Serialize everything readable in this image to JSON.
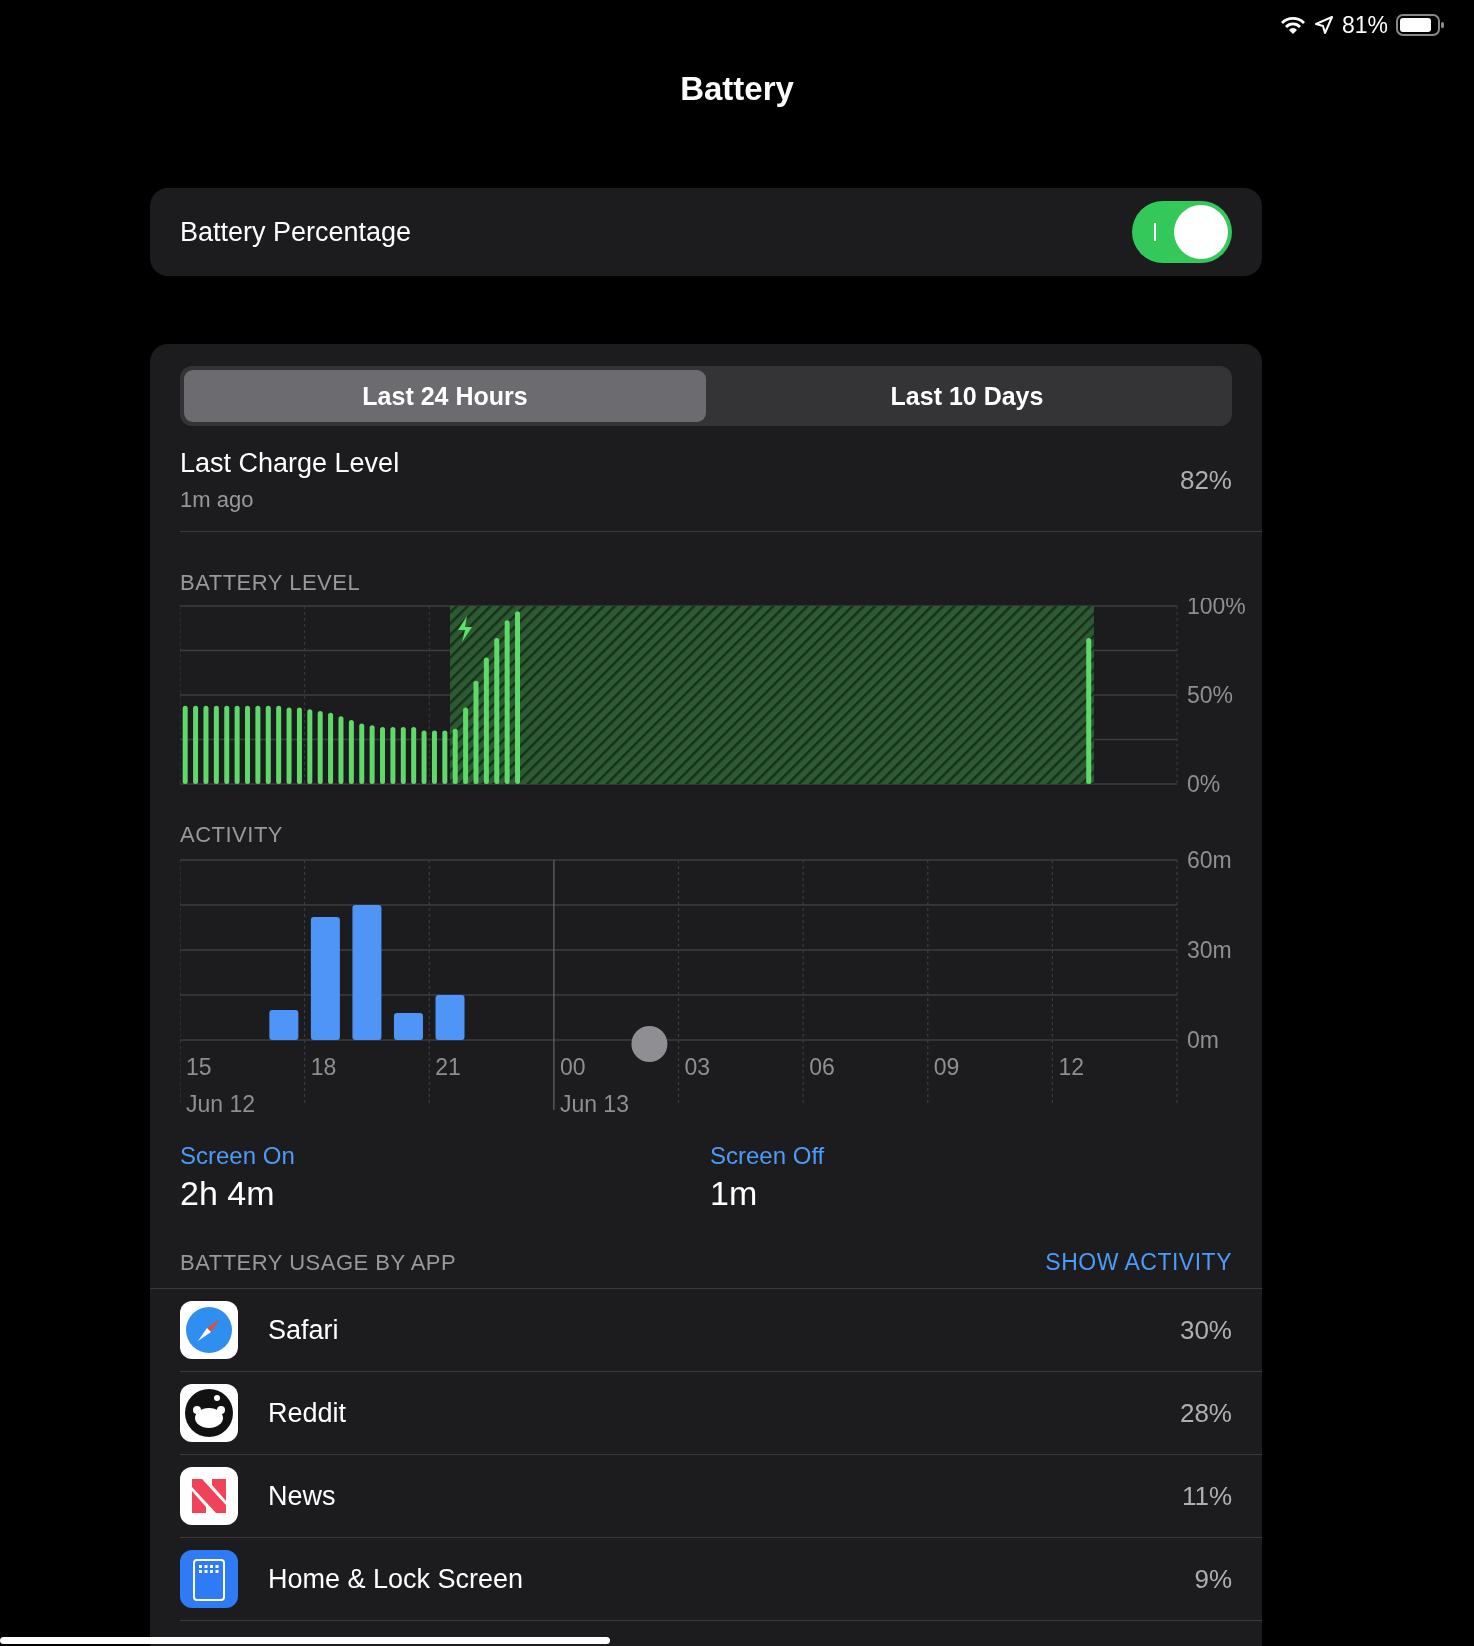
{
  "status_bar": {
    "battery_percent": "81%"
  },
  "title": "Battery",
  "battery_percentage": {
    "label": "Battery Percentage",
    "on": true
  },
  "tabs": [
    {
      "label": "Last 24 Hours",
      "selected": true
    },
    {
      "label": "Last 10 Days",
      "selected": false
    }
  ],
  "last_charge": {
    "label": "Last Charge Level",
    "time": "1m ago",
    "value": "82%"
  },
  "battery_level": {
    "chart_data": {
      "type": "bar",
      "title": "BATTERY LEVEL",
      "ylim": [
        0,
        100
      ],
      "yticks": [
        {
          "value": 0,
          "label": "0%"
        },
        {
          "value": 50,
          "label": "50%"
        },
        {
          "value": 100,
          "label": "100%"
        }
      ],
      "values": [
        44,
        44,
        44,
        44,
        44,
        44,
        44,
        44,
        44,
        44,
        43,
        43,
        42,
        41,
        40,
        38,
        36,
        34,
        33,
        32,
        32,
        32,
        32,
        30,
        30,
        30,
        31,
        43,
        58,
        71,
        82,
        92,
        97,
        null,
        null,
        null,
        null,
        null,
        null,
        null,
        null,
        null,
        null,
        null,
        null,
        null,
        null,
        null,
        null,
        null,
        null,
        null,
        null,
        null,
        null,
        null,
        null,
        null,
        null,
        null,
        null,
        null,
        null,
        null,
        null,
        null,
        null,
        null,
        null,
        null,
        null,
        null,
        null,
        null,
        null,
        null,
        null,
        null,
        null,
        null,
        null,
        null,
        null,
        null,
        null,
        null,
        null,
        82,
        null,
        null,
        null,
        null,
        null,
        null,
        null,
        null
      ]
    }
  },
  "activity": {
    "chart_data": {
      "type": "bar",
      "title": "ACTIVITY",
      "ylim": [
        0,
        60
      ],
      "yticks": [
        {
          "value": 0,
          "label": "0m"
        },
        {
          "value": 30,
          "label": "30m"
        },
        {
          "value": 60,
          "label": "60m"
        }
      ],
      "categories": [
        "15",
        null,
        null,
        "18",
        null,
        null,
        "21",
        null,
        null,
        "00",
        null,
        null,
        "03",
        null,
        null,
        "06",
        null,
        null,
        "09",
        null,
        null,
        "12",
        null,
        null
      ],
      "values": [
        0,
        0,
        10,
        41,
        45,
        9,
        15,
        0,
        0,
        0,
        0,
        0,
        0,
        0,
        0,
        0,
        0,
        0,
        0,
        0,
        0,
        0,
        0,
        0
      ]
    },
    "dates": [
      "Jun 12",
      "Jun 13"
    ]
  },
  "screen_time": [
    {
      "label": "Screen On",
      "value": "2h 4m"
    },
    {
      "label": "Screen Off",
      "value": "1m"
    }
  ],
  "usage": {
    "title": "BATTERY USAGE BY APP",
    "action": "SHOW ACTIVITY",
    "apps": [
      {
        "kind": "safari",
        "name": "Safari",
        "value": "30%"
      },
      {
        "kind": "reddit",
        "name": "Reddit",
        "value": "28%"
      },
      {
        "kind": "news",
        "name": "News",
        "value": "11%"
      },
      {
        "kind": "home",
        "name": "Home & Lock Screen",
        "value": "9%"
      }
    ]
  }
}
